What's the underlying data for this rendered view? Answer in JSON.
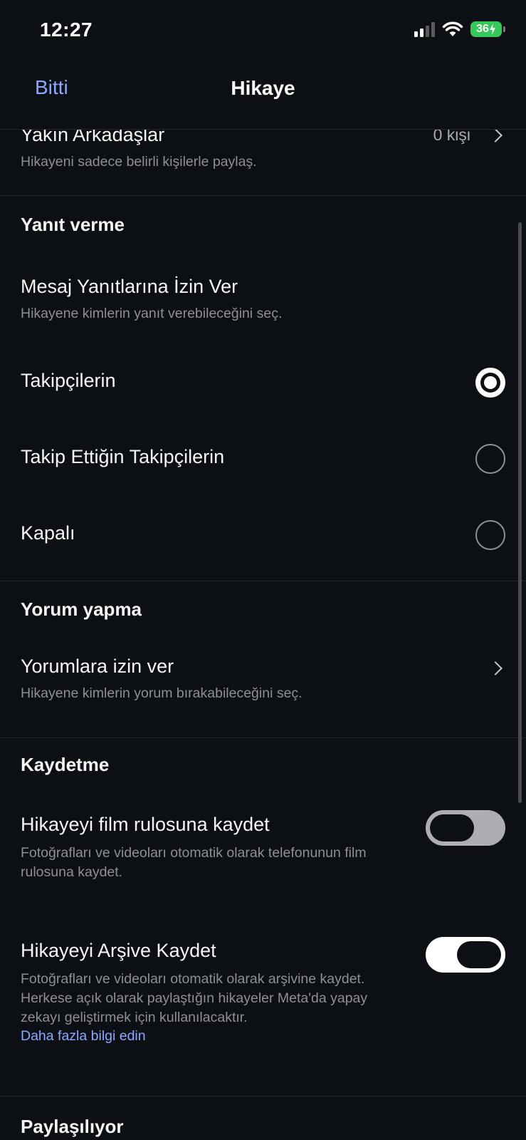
{
  "status": {
    "time": "12:27",
    "battery": "36"
  },
  "nav": {
    "done": "Bitti",
    "title": "Hikaye"
  },
  "close_friends": {
    "title": "Yakın Arkadaşlar",
    "subtitle": "Hikayeni sadece belirli kişilerle paylaş.",
    "value": "0 kişi"
  },
  "replies": {
    "header": "Yanıt verme",
    "title": "Mesaj Yanıtlarına İzin Ver",
    "subtitle": "Hikayene kimlerin yanıt verebileceğini seç.",
    "options": [
      {
        "label": "Takipçilerin",
        "selected": true
      },
      {
        "label": "Takip Ettiğin Takipçilerin",
        "selected": false
      },
      {
        "label": "Kapalı",
        "selected": false
      }
    ]
  },
  "comments": {
    "header": "Yorum yapma",
    "title": "Yorumlara izin ver",
    "subtitle": "Hikayene kimlerin yorum bırakabileceğini seç."
  },
  "saving": {
    "header": "Kaydetme",
    "camera_roll": {
      "title": "Hikayeyi film rulosuna kaydet",
      "subtitle": "Fotoğrafları ve videoları otomatik olarak telefonunun film rulosuna kaydet.",
      "enabled": false
    },
    "archive": {
      "title": "Hikayeyi Arşive Kaydet",
      "subtitle": "Fotoğrafları ve videoları otomatik olarak arşivine kaydet. Herkese açık olarak paylaştığın hikayeler Meta'da yapay zekayı geliştirmek için kullanılacaktır.",
      "link": "Daha fazla bilgi edin",
      "enabled": true
    }
  },
  "sharing": {
    "header": "Paylaşılıyor"
  },
  "icons": {
    "signal": "cellular-signal-icon",
    "wifi": "wifi-icon",
    "battery": "battery-charging-icon",
    "chevron": "chevron-right-icon"
  },
  "colors": {
    "background": "#0c1014",
    "accent_link": "#8aa8ff",
    "battery_green": "#35c759"
  }
}
